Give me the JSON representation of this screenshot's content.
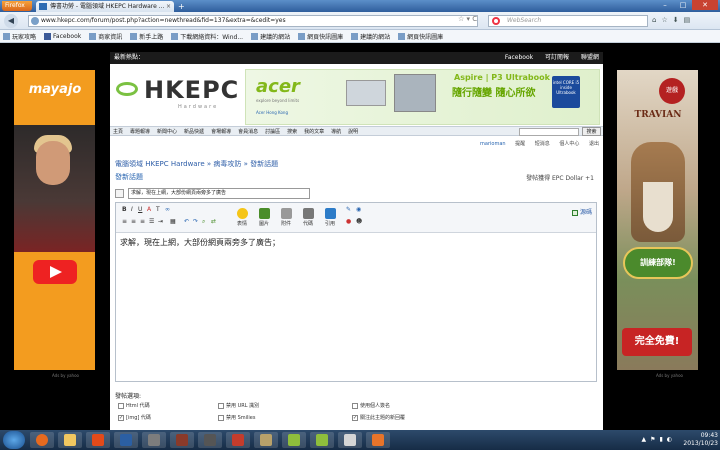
{
  "browser": {
    "app_button": "Firefox",
    "tab_title": "傳書功勞 - 電腦領域 HKEPC Hardware ...",
    "url": "www.hkepc.com/forum/post.php?action=newthread&fid=137&extra=&cedit=yes",
    "search_placeholder": "WebSearch",
    "bookmarks": [
      "玩家攻略",
      "Facebook",
      "商家資訊",
      "新手上路",
      "下載網絡資料：Wind...",
      "建議的網站",
      "網頁快訊圖庫",
      "建議的網站",
      "網頁快訊圖庫"
    ]
  },
  "left_ad": {
    "brand": "mayajo",
    "footer": "Ads by yahoo"
  },
  "right_ad": {
    "brand": "TRAVIAN",
    "seal": "遊戲",
    "shield": "訓練部隊!",
    "cta": "完全免費!",
    "footer": "Ads by yahoo"
  },
  "site": {
    "topstrip_left": "最新熱點：",
    "topstrip_links": [
      "Facebook",
      "可訂閱報",
      "聯盟網"
    ],
    "logo": "HKEPC",
    "logo_sub": "Hardware",
    "banner": {
      "brand": "acer",
      "tag": "explore beyond limits",
      "store": "Acer Hong Kong",
      "line1": "Aspire | P3 Ultrabook",
      "line2": "隨行隨變 隨心所欲",
      "intel": "intel CORE i5 inside Ultrabook"
    },
    "menu": [
      "主頁",
      "專題報導",
      "新聞中心",
      "新品快遞",
      "會場報導",
      "會員消息",
      "討論區",
      "搜索",
      "我的文章",
      "導航",
      "說明"
    ],
    "search_button": "搜索",
    "user": [
      "marioman",
      "提醒",
      "短消息",
      "個人中心",
      "退出"
    ],
    "breadcrumb": "電腦領域 HKEPC Hardware » 病毒攻防 » 發新話題",
    "new_topic": "發新話題",
    "dollar": "發帖獲得 EPC Dollar +1",
    "subject": "求解，現在上網，大部份網頁兩旁多了廣告",
    "toolbar_big": [
      "表情",
      "圖片",
      "附件",
      "代碼",
      "引用"
    ],
    "rich_label": "源碼",
    "editor_text": "求解，現在上網，大部份網頁兩旁多了廣告；",
    "options_label": "發帖選項:",
    "options": [
      {
        "label": "Html 代碼",
        "checked": false
      },
      {
        "label": "[img] 代碼",
        "checked": true
      },
      {
        "label": "禁用 URL 識別",
        "checked": false
      },
      {
        "label": "禁用 Smilies",
        "checked": false
      },
      {
        "label": "使用個人簽名",
        "checked": false
      },
      {
        "label": "關注此主題的新回覆",
        "checked": true
      }
    ]
  },
  "taskbar": {
    "time": "09:43",
    "date": "2013/10/23"
  }
}
